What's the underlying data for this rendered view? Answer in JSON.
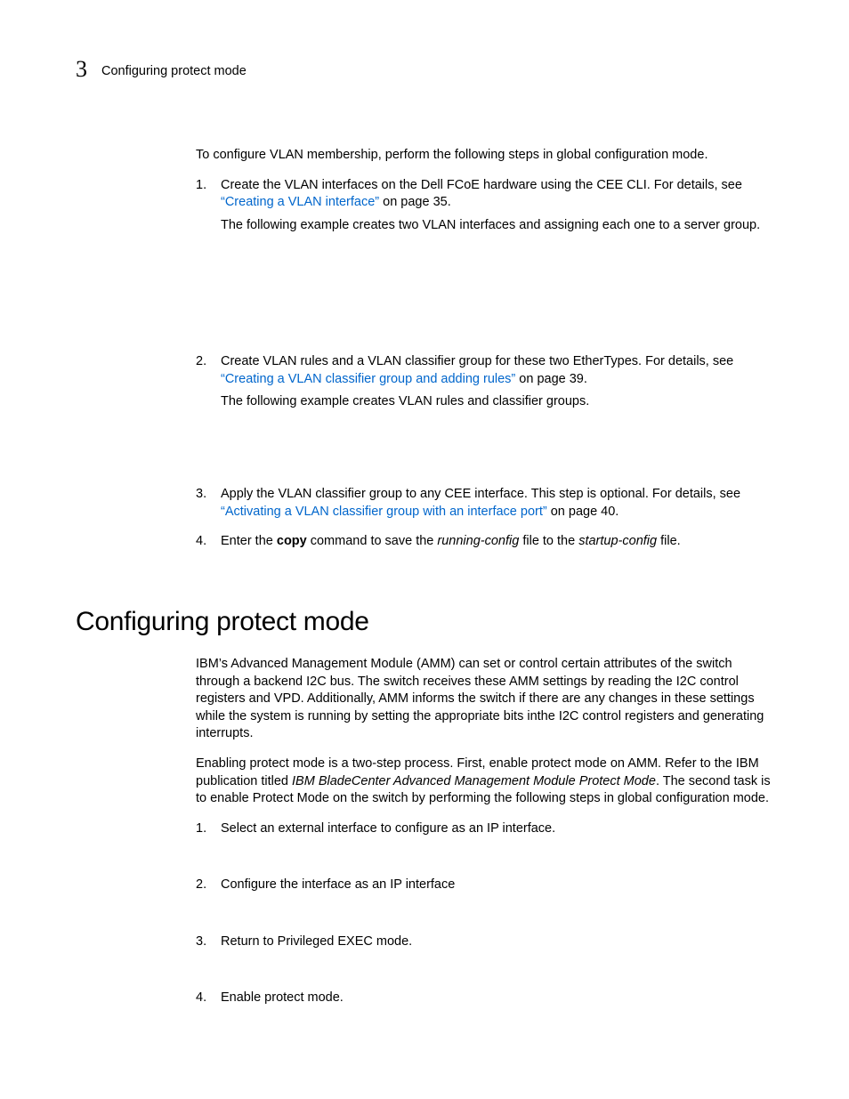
{
  "header": {
    "chapter_number": "3",
    "chapter_title": "Configuring protect mode"
  },
  "body": {
    "intro": "To configure VLAN membership, perform the following steps in global configuration mode.",
    "steps": [
      {
        "num": "1.",
        "text_before_link": "Create the VLAN interfaces on the Dell FCoE hardware using the CEE CLI. For details, see ",
        "link": "“Creating a VLAN interface”",
        "text_after_link": " on page 35.",
        "sub": "The following example creates two VLAN interfaces and assigning each one to a server group."
      },
      {
        "num": "2.",
        "text_before_link": "Create VLAN rules and a VLAN classifier group for these two EtherTypes. For details, see ",
        "link": "“Creating a VLAN classifier group and adding rules”",
        "text_after_link": " on page 39.",
        "sub": "The following example creates VLAN rules and classifier groups."
      },
      {
        "num": "3.",
        "text_before_link": "Apply the VLAN classifier group to any CEE interface. This step is optional. For details, see ",
        "link": "“Activating a VLAN classifier group with an interface port”",
        "text_after_link": " on page 40."
      },
      {
        "num": "4.",
        "pre": "Enter the ",
        "bold": "copy",
        "mid": " command to save the ",
        "it1": "running-config",
        "mid2": " file to the ",
        "it2": "startup-config",
        "post": " file."
      }
    ]
  },
  "section": {
    "title": "Configuring protect mode",
    "para1": "IBM’s Advanced Management Module (AMM) can set or control certain attributes of the switch through a backend I2C bus. The switch receives these AMM settings by reading the I2C control registers and VPD.  Additionally, AMM informs the switch if there are any changes in these settings while the system is running by setting the appropriate bits inthe I2C control registers and generating interrupts.",
    "para2_pre": "Enabling protect mode is a two-step process. First, enable protect mode on  AMM. Refer to the IBM publication titled ",
    "para2_it": "IBM BladeCenter Advanced Management Module Protect Mode",
    "para2_post": ". The second task is to enable Protect Mode on the switch by performing the following steps in global configuration mode.",
    "steps": [
      {
        "num": "1.",
        "text": "Select an external interface to configure as an IP interface."
      },
      {
        "num": "2.",
        "text": "Configure the interface as an IP interface"
      },
      {
        "num": "3.",
        "text": "Return to Privileged EXEC mode."
      },
      {
        "num": "4.",
        "text": "Enable protect mode."
      }
    ]
  }
}
